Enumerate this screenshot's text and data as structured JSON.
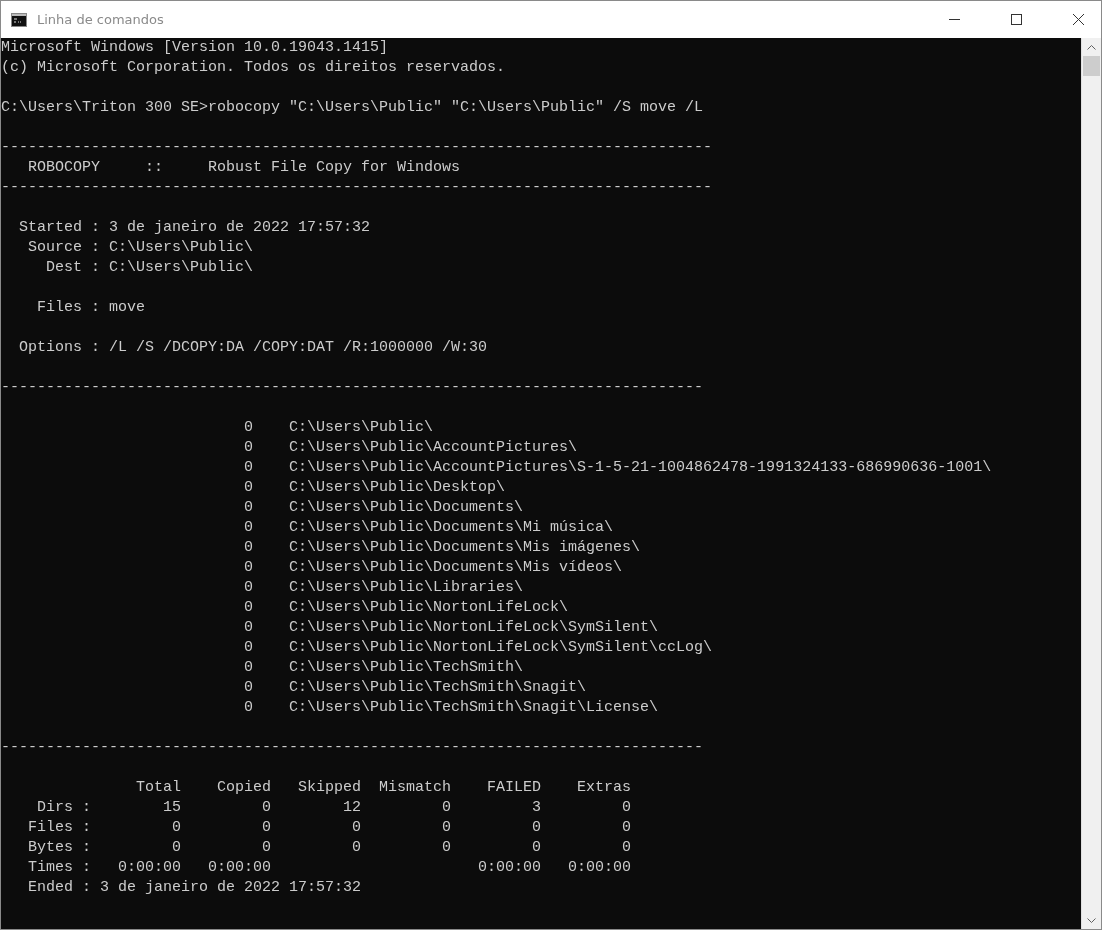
{
  "window": {
    "title": "Linha de comandos"
  },
  "console": {
    "blocks": [
      [
        "Microsoft Windows [Version 10.0.19043.1415]",
        "(c) Microsoft Corporation. Todos os direitos reservados."
      ],
      [
        "C:\\Users\\Triton 300 SE>robocopy \"C:\\Users\\Public\" \"C:\\Users\\Public\" /S move /L"
      ],
      [
        "-------------------------------------------------------------------------------",
        "   ROBOCOPY     ::     Robust File Copy for Windows",
        "-------------------------------------------------------------------------------"
      ],
      [
        "  Started : 3 de janeiro de 2022 17:57:32",
        "   Source : C:\\Users\\Public\\",
        "     Dest : C:\\Users\\Public\\"
      ],
      [
        "    Files : move"
      ],
      [
        "  Options : /L /S /DCOPY:DA /COPY:DAT /R:1000000 /W:30"
      ],
      [
        "------------------------------------------------------------------------------"
      ],
      [
        "                           0    C:\\Users\\Public\\",
        "                           0    C:\\Users\\Public\\AccountPictures\\",
        "                           0    C:\\Users\\Public\\AccountPictures\\S-1-5-21-1004862478-1991324133-686990636-1001\\",
        "                           0    C:\\Users\\Public\\Desktop\\",
        "                           0    C:\\Users\\Public\\Documents\\",
        "                           0    C:\\Users\\Public\\Documents\\Mi música\\",
        "                           0    C:\\Users\\Public\\Documents\\Mis imágenes\\",
        "                           0    C:\\Users\\Public\\Documents\\Mis vídeos\\",
        "                           0    C:\\Users\\Public\\Libraries\\",
        "                           0    C:\\Users\\Public\\NortonLifeLock\\",
        "                           0    C:\\Users\\Public\\NortonLifeLock\\SymSilent\\",
        "                           0    C:\\Users\\Public\\NortonLifeLock\\SymSilent\\ccLog\\",
        "                           0    C:\\Users\\Public\\TechSmith\\",
        "                           0    C:\\Users\\Public\\TechSmith\\Snagit\\",
        "                           0    C:\\Users\\Public\\TechSmith\\Snagit\\License\\"
      ],
      [
        "------------------------------------------------------------------------------"
      ],
      [
        "               Total    Copied   Skipped  Mismatch    FAILED    Extras",
        "    Dirs :        15         0        12         0         3         0",
        "   Files :         0         0         0         0         0         0",
        "   Bytes :         0         0         0         0         0         0",
        "   Times :   0:00:00   0:00:00                       0:00:00   0:00:00",
        "   Ended : 3 de janeiro de 2022 17:57:32"
      ]
    ]
  }
}
